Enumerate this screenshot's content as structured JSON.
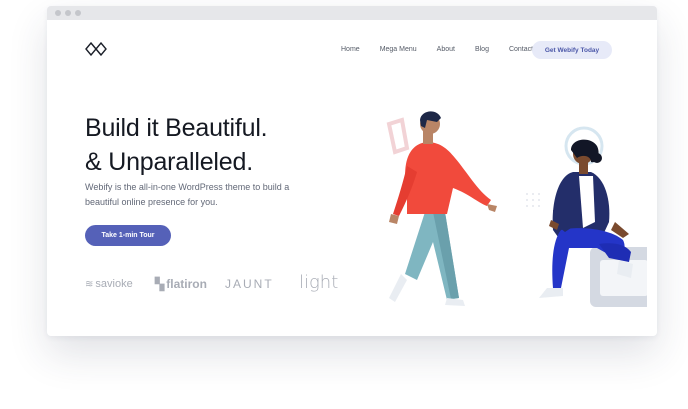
{
  "nav": {
    "links": [
      "Home",
      "Mega Menu",
      "About",
      "Blog",
      "Contact"
    ],
    "cta": "Get Webify Today"
  },
  "hero": {
    "title_line1": "Build it Beautiful.",
    "title_line2": "& Unparalleled.",
    "subtitle": "Webify is the all-in-one WordPress theme to build a beautiful online presence for you.",
    "button": "Take 1-min Tour"
  },
  "brands": [
    "savioke",
    "flatiron",
    "JAUNT",
    "light"
  ],
  "colors": {
    "accent": "#5561b8",
    "cta_bg": "#e7eaf8",
    "heading": "#151922",
    "muted": "#a8acb5"
  }
}
